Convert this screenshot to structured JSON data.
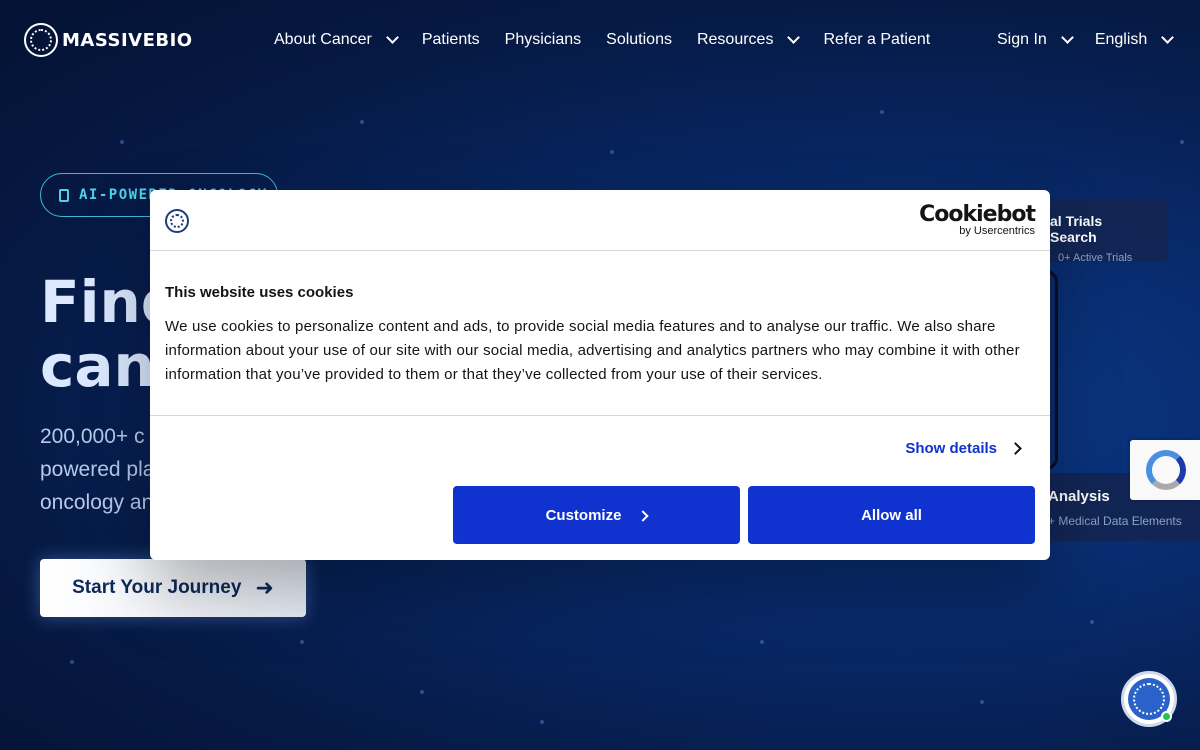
{
  "header": {
    "logo_text": "MASSIVEBIO",
    "nav": [
      {
        "label": "About Cancer",
        "has_dropdown": true
      },
      {
        "label": "Patients",
        "has_dropdown": false
      },
      {
        "label": "Physicians",
        "has_dropdown": false
      },
      {
        "label": "Solutions",
        "has_dropdown": false
      },
      {
        "label": "Resources",
        "has_dropdown": true
      },
      {
        "label": "Refer a Patient",
        "has_dropdown": false
      }
    ],
    "sign_in": "Sign In",
    "language": "English"
  },
  "hero": {
    "badge": "AI-POWERED ONCOLOGY",
    "title_line1": "Find",
    "title_line2": "canc",
    "subtitle_line1": "200,000+ c",
    "subtitle_line2": "powered pla",
    "subtitle_line3": "oncology an",
    "cta_label": "Start Your Journey"
  },
  "cards": {
    "trials_title": "al Trials Search",
    "trials_sub": "0+ Active Trials",
    "analysis_title": "Analysis",
    "analysis_sub": "+ Medical Data Elements"
  },
  "cookie": {
    "provider_name": "Cookiebot",
    "provider_by": "by Usercentrics",
    "title": "This website uses cookies",
    "text": "We use cookies to personalize content and ads, to provide social media features and to analyse our traffic. We also share information about your use of our site with our social media, advertising and analytics partners who may combine it with other information that you’ve provided to them or that they’ve collected from your use of their services.",
    "show_details": "Show details",
    "customize": "Customize",
    "allow_all": "Allow all"
  },
  "colors": {
    "accent": "#1032cf",
    "badge": "#4fd1ee",
    "background": "#082a6b"
  }
}
